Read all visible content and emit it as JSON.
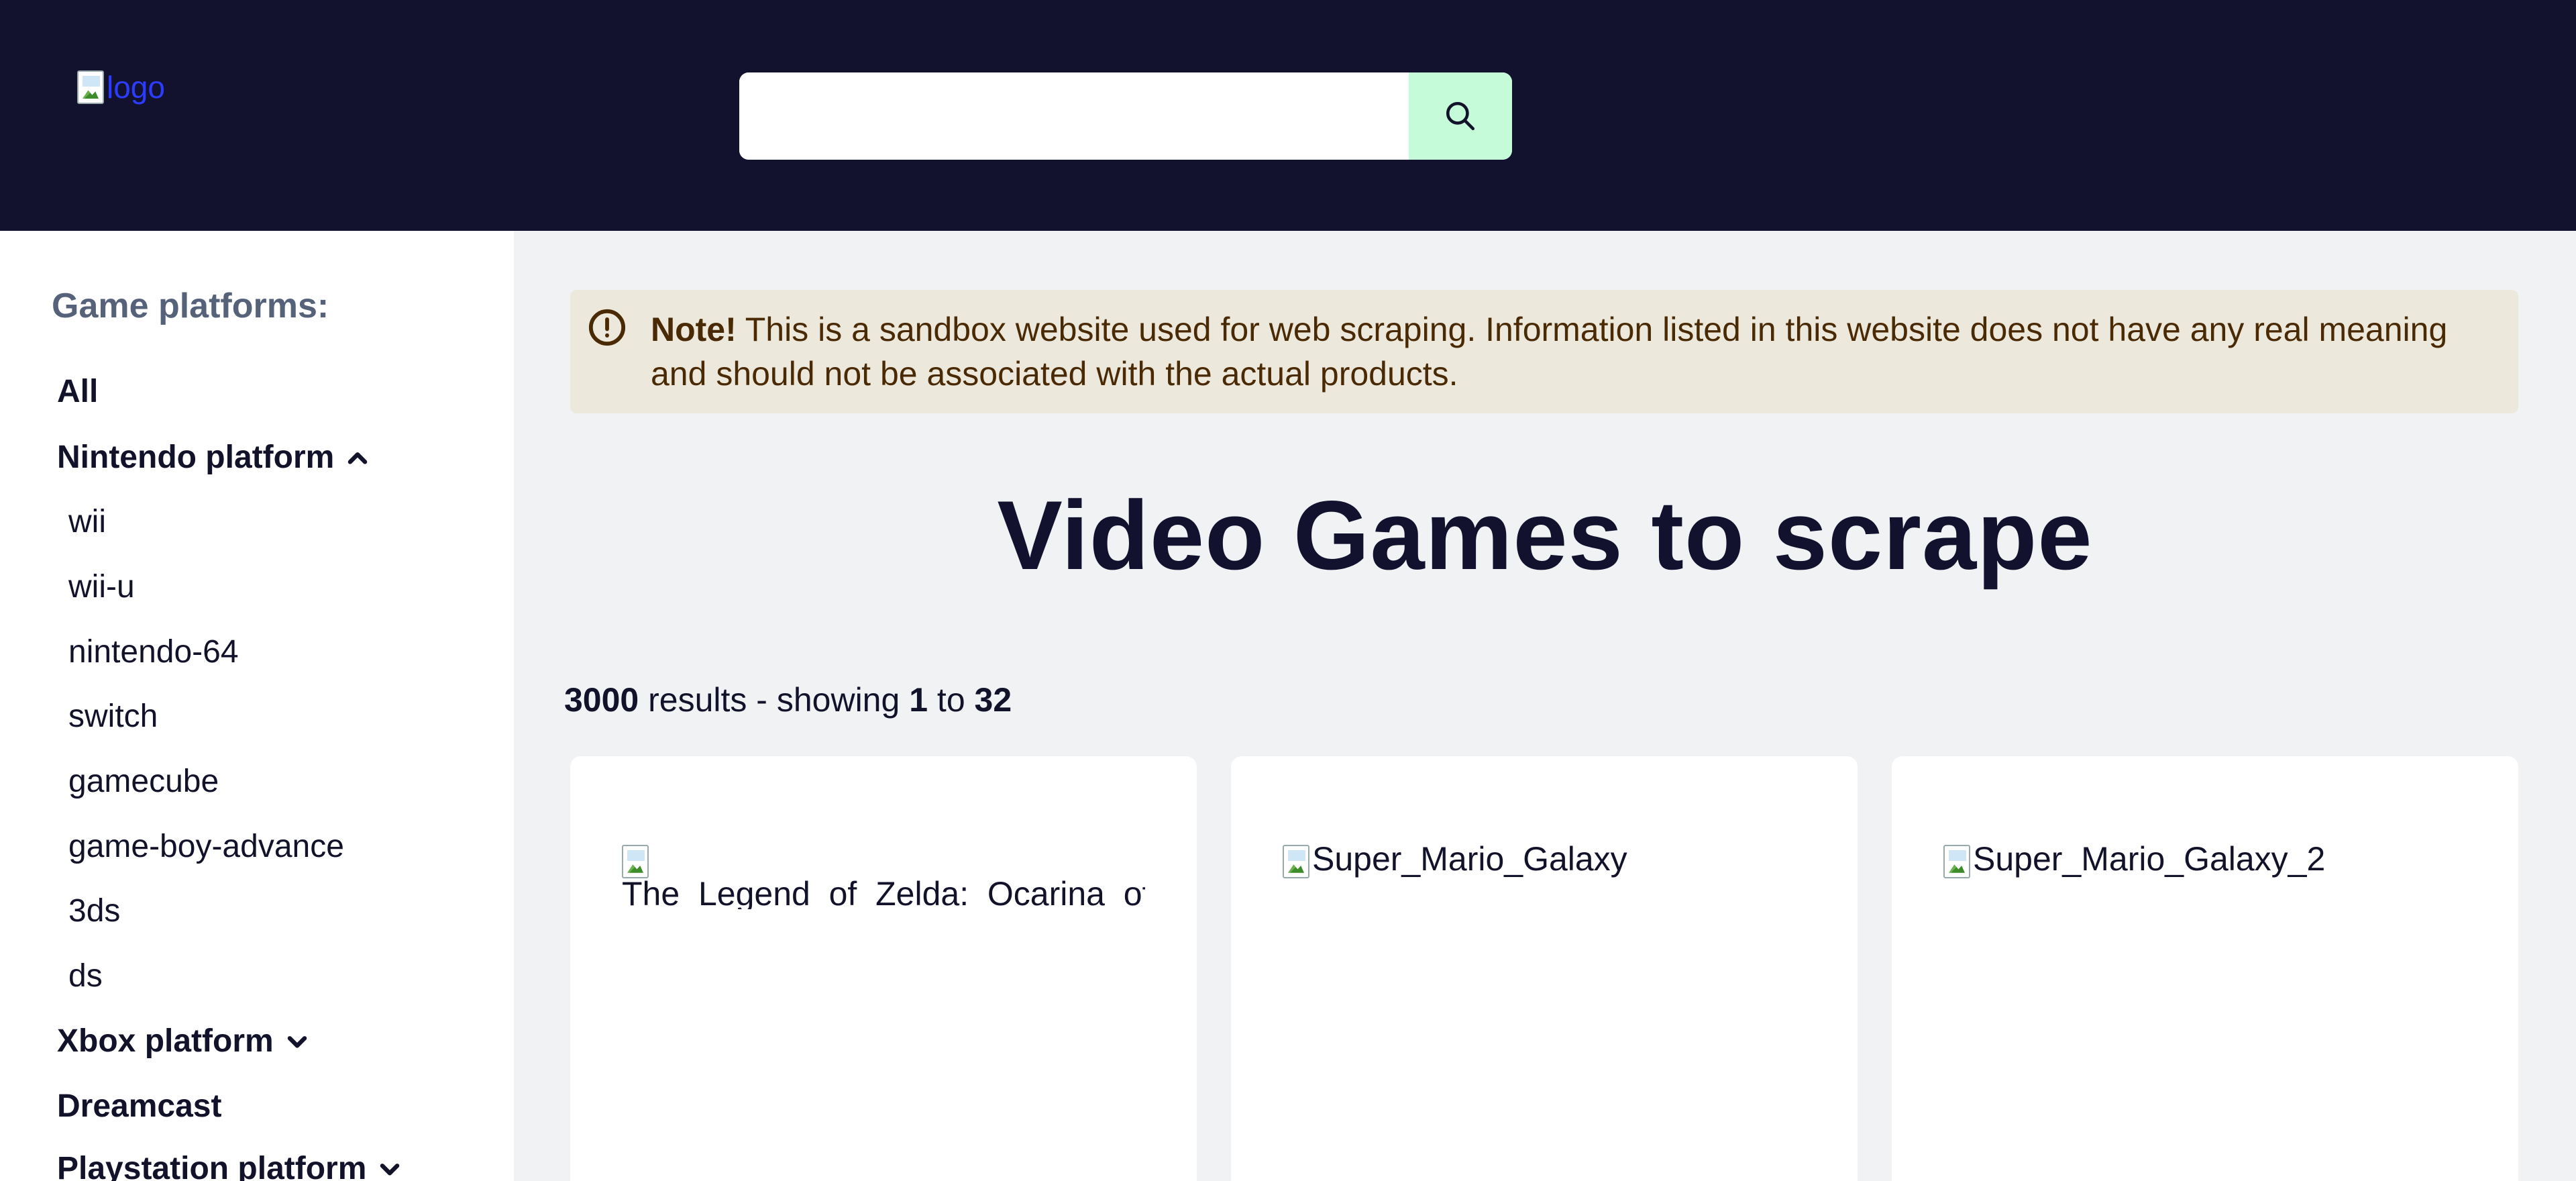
{
  "header": {
    "logo_alt": "logo",
    "search": {
      "value": "",
      "placeholder": ""
    },
    "search_button_icon": "search-icon"
  },
  "sidebar": {
    "title": "Game platforms:",
    "all_label": "All",
    "nintendo": {
      "label": "Nintendo platform",
      "expanded": true,
      "icon": "chevron-up-icon",
      "items": [
        "wii",
        "wii-u",
        "nintendo-64",
        "switch",
        "gamecube",
        "game-boy-advance",
        "3ds",
        "ds"
      ]
    },
    "xbox": {
      "label": "Xbox platform",
      "icon": "chevron-down-icon"
    },
    "dreamcast": {
      "label": "Dreamcast"
    },
    "playstation": {
      "label": "Playstation platform",
      "icon": "chevron-down-icon"
    }
  },
  "note": {
    "icon": "alert-circle-icon",
    "bold": "Note!",
    "text": "This is a sandbox website used for web scraping. Information listed in this website does not have any real meaning and should not be associated with the actual products."
  },
  "main": {
    "title": "Video Games to scrape",
    "results": {
      "total": "3000",
      "middle": "results - showing",
      "from": "1",
      "to_word": "to",
      "to": "32"
    }
  },
  "cards": [
    {
      "image_alt": "The_Legend_of_Zelda:_Ocarina_of_Time"
    },
    {
      "image_alt": "Super_Mario_Galaxy"
    },
    {
      "image_alt": "Super_Mario_Galaxy_2"
    }
  ],
  "colors": {
    "header_bg": "#12122e",
    "search_button_bg": "#c6fbd9",
    "note_bg": "#ede8dc",
    "note_text": "#4a2a05",
    "page_bg": "#f1f2f4"
  }
}
